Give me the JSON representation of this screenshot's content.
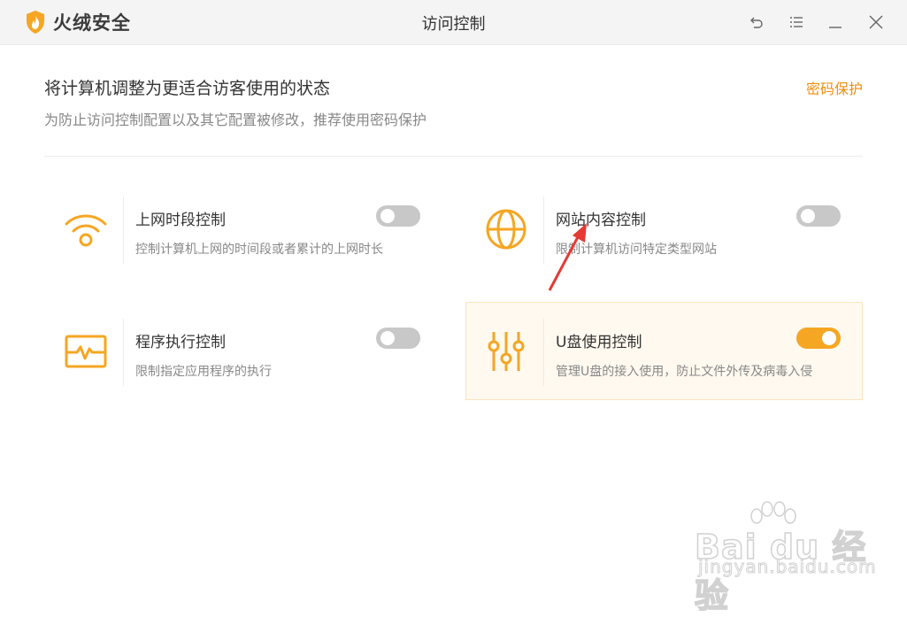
{
  "app": {
    "name": "火绒安全",
    "window_title": "访问控制"
  },
  "window_controls": {
    "back_icon": "undo-icon",
    "menu_icon": "menu-icon",
    "minimize_icon": "minimize-icon",
    "close_icon": "close-icon"
  },
  "header": {
    "title": "将计算机调整为更适合访客使用的状态",
    "subtitle": "为防止访问控制配置以及其它配置被修改，推荐使用密码保护",
    "password_link": "密码保护"
  },
  "cards": [
    {
      "title": "上网时段控制",
      "desc": "控制计算机上网的时间段或者累计的上网时长",
      "icon": "wifi-icon",
      "enabled": false
    },
    {
      "title": "网站内容控制",
      "desc": "限制计算机访问特定类型网站",
      "icon": "globe-icon",
      "enabled": false
    },
    {
      "title": "程序执行控制",
      "desc": "限制指定应用程序的执行",
      "icon": "monitor-pulse-icon",
      "enabled": false
    },
    {
      "title": "U盘使用控制",
      "desc": "管理U盘的接入使用，防止文件外传及病毒入侵",
      "icon": "sliders-icon",
      "enabled": true
    }
  ],
  "colors": {
    "accent": "#f5a623",
    "link": "#ee8f11",
    "annotation": "#e53935"
  },
  "watermark": {
    "main": "Bai du 经验",
    "sub": "jingyan.baidu.com"
  }
}
